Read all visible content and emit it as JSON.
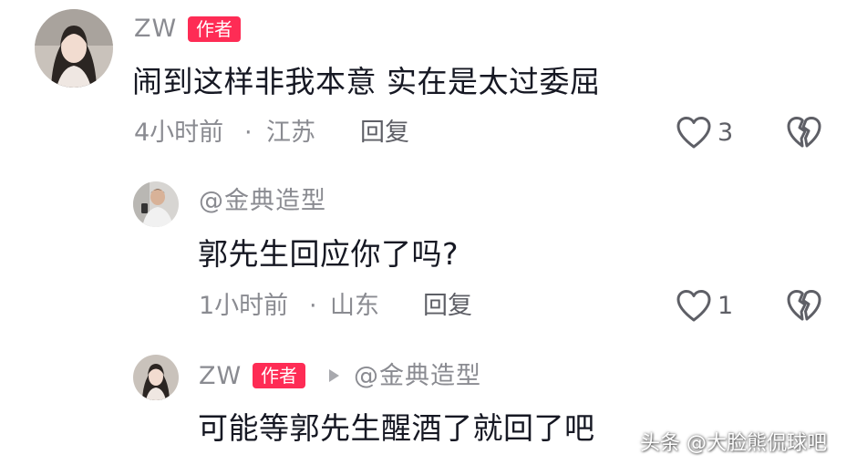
{
  "comments": [
    {
      "author": "ZW",
      "badge": "作者",
      "text": "闹到这样非我本意 实在是太过委屈",
      "time": "4小时前",
      "location": "江苏",
      "reply_label": "回复",
      "likes": "3"
    },
    {
      "author": "@金典造型",
      "text": "郭先生回应你了吗?",
      "time": "1小时前",
      "location": "山东",
      "reply_label": "回复",
      "likes": "1"
    },
    {
      "author": "ZW",
      "badge": "作者",
      "reply_to": "@金典造型",
      "text": "可能等郭先生醒酒了就回了吧"
    }
  ],
  "separator": "·",
  "watermark": "头条 @大脸熊侃球吧",
  "icons": {
    "like": "heart-outline-icon",
    "dislike": "broken-heart-icon",
    "reply_arrow": "triangle-right-icon"
  },
  "colors": {
    "badge": "#fe2c55",
    "text": "#161823",
    "meta": "#8a8b91"
  }
}
